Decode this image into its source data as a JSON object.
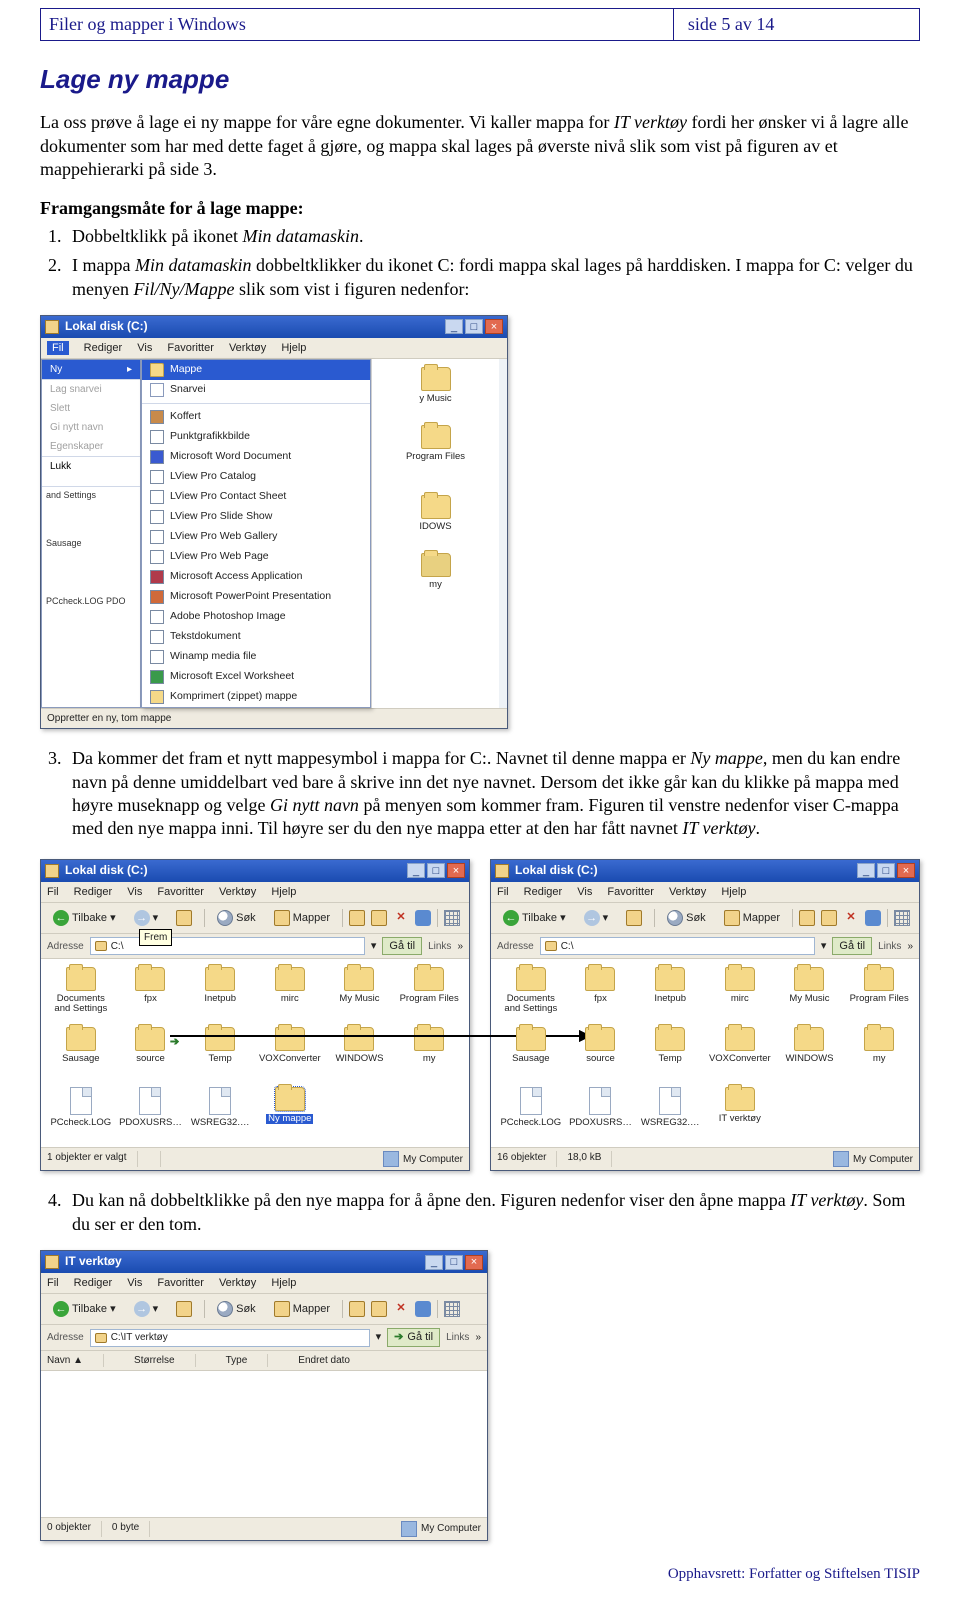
{
  "header": {
    "left": "Filer og mapper i Windows",
    "right": "side 5 av 14"
  },
  "section_title": "Lage ny mappe",
  "intro_a": "La oss prøve å lage ei ny mappe for våre egne dokumenter. Vi kaller mappa for ",
  "intro_it": "IT verktøy",
  "intro_b": " fordi her ønsker vi å lagre alle dokumenter som har med dette faget å gjøre, og mappa skal lages på øverste nivå slik som vist på figuren av et mappehierarki på side 3.",
  "proc_label": "Framgangsmåte for å lage mappe:",
  "step1_a": "Dobbeltklikk på ikonet ",
  "step1_it": "Min datamaskin",
  "step1_b": ".",
  "step2_a": "I mappa ",
  "step2_it1": "Min datamaskin",
  "step2_b": " dobbeltklikker du ikonet C: fordi mappa skal lages på harddisken. I mappa for C: velger du menyen ",
  "step2_it2": "Fil/Ny/Mappe",
  "step2_c": " slik som vist i figuren nedenfor:",
  "win1": {
    "title": "Lokal disk (C:)",
    "menu": [
      "Fil",
      "Rediger",
      "Vis",
      "Favoritter",
      "Verktøy",
      "Hjelp"
    ],
    "filemenu": {
      "ny": "Ny",
      "items_dim": [
        "Lag snarvei",
        "Slett",
        "Gi nytt navn",
        "Egenskaper"
      ],
      "lukk": "Lukk"
    },
    "submenu": [
      {
        "type": "sel",
        "label": "Mappe"
      },
      {
        "type": "row",
        "label": "Snarvei"
      },
      {
        "type": "hr"
      },
      {
        "type": "row",
        "label": "Koffert"
      },
      {
        "type": "row",
        "label": "Punktgrafikkbilde"
      },
      {
        "type": "row",
        "label": "Microsoft Word Document"
      },
      {
        "type": "row",
        "label": "LView Pro Catalog"
      },
      {
        "type": "row",
        "label": "LView Pro Contact Sheet"
      },
      {
        "type": "row",
        "label": "LView Pro Slide Show"
      },
      {
        "type": "row",
        "label": "LView Pro Web Gallery"
      },
      {
        "type": "row",
        "label": "LView Pro Web Page"
      },
      {
        "type": "row",
        "label": "Microsoft Access Application"
      },
      {
        "type": "row",
        "label": "Microsoft PowerPoint Presentation"
      },
      {
        "type": "row",
        "label": "Adobe Photoshop Image"
      },
      {
        "type": "row",
        "label": "Tekstdokument"
      },
      {
        "type": "row",
        "label": "Winamp media file"
      },
      {
        "type": "row",
        "label": "Microsoft Excel Worksheet"
      },
      {
        "type": "row",
        "label": "Komprimert (zippet) mappe"
      }
    ],
    "peek": [
      "y Music",
      "Program Files",
      "IDOWS",
      "my"
    ],
    "sidebar_extra": [
      "and Settings",
      "Sausage",
      "PCcheck.LOG  PDO"
    ],
    "status": "Oppretter en ny, tom mappe"
  },
  "step3_a": "Da kommer det fram et nytt mappesymbol i mappa for C:. Navnet til denne mappa er ",
  "step3_it1": "Ny mappe",
  "step3_b": ", men du kan endre navn på denne umiddelbart ved bare å skrive inn det nye navnet. Dersom det ikke går kan du klikke på mappa med høyre museknapp og velge ",
  "step3_it2": "Gi nytt navn",
  "step3_c": " på menyen som kommer fram. Figuren til venstre nedenfor viser C-mappa med den nye mappa inni. Til høyre ser du den nye mappa etter at den har fått navnet ",
  "step3_it3": "IT verktøy",
  "step3_d": ".",
  "tb": {
    "tilbake": "Tilbake",
    "sok": "Søk",
    "mapper": "Mapper",
    "gatil": "Gå til",
    "links": "Links",
    "frem_tip": "Frem"
  },
  "addr": {
    "label": "Adresse",
    "value": "C:\\",
    "value2": "C:\\IT verktøy"
  },
  "win2L": {
    "title": "Lokal disk (C:)",
    "folders": [
      "Documents and Settings",
      "fpx",
      "Inetpub",
      "mirc",
      "My Music",
      "Program Files",
      "Sausage",
      "source",
      "Temp",
      "VOXConverter",
      "WINDOWS",
      "my"
    ],
    "files": [
      "PCcheck.LOG",
      "PDOXUSRS…",
      "WSREG32.…"
    ],
    "new_label": "Ny mappe",
    "status_left": "1 objekter er valgt",
    "status_right": "My Computer"
  },
  "win2R": {
    "title": "Lokal disk (C:)",
    "folders": [
      "Documents and Settings",
      "fpx",
      "Inetpub",
      "mirc",
      "My Music",
      "Program Files",
      "Sausage",
      "source",
      "Temp",
      "VOXConverter",
      "WINDOWS",
      "my"
    ],
    "files": [
      "PCcheck.LOG",
      "PDOXUSRS…",
      "WSREG32.…"
    ],
    "it_label": "IT verktøy",
    "status_left": "16 objekter",
    "status_mid": "18,0 kB",
    "status_right": "My Computer"
  },
  "step4_a": "Du kan nå dobbeltklikke på den nye mappa for å åpne den. Figuren nedenfor viser den åpne mappa ",
  "step4_it": "IT verktøy",
  "step4_b": ". Som du ser er den tom.",
  "win3": {
    "title": "IT verktøy",
    "cols": [
      "Navn  ▲",
      "Størrelse",
      "Type",
      "Endret dato"
    ],
    "status_left": "0 objekter",
    "status_mid": "0 byte",
    "status_right": "My Computer"
  },
  "footer": "Opphavsrett:  Forfatter og Stiftelsen TISIP"
}
